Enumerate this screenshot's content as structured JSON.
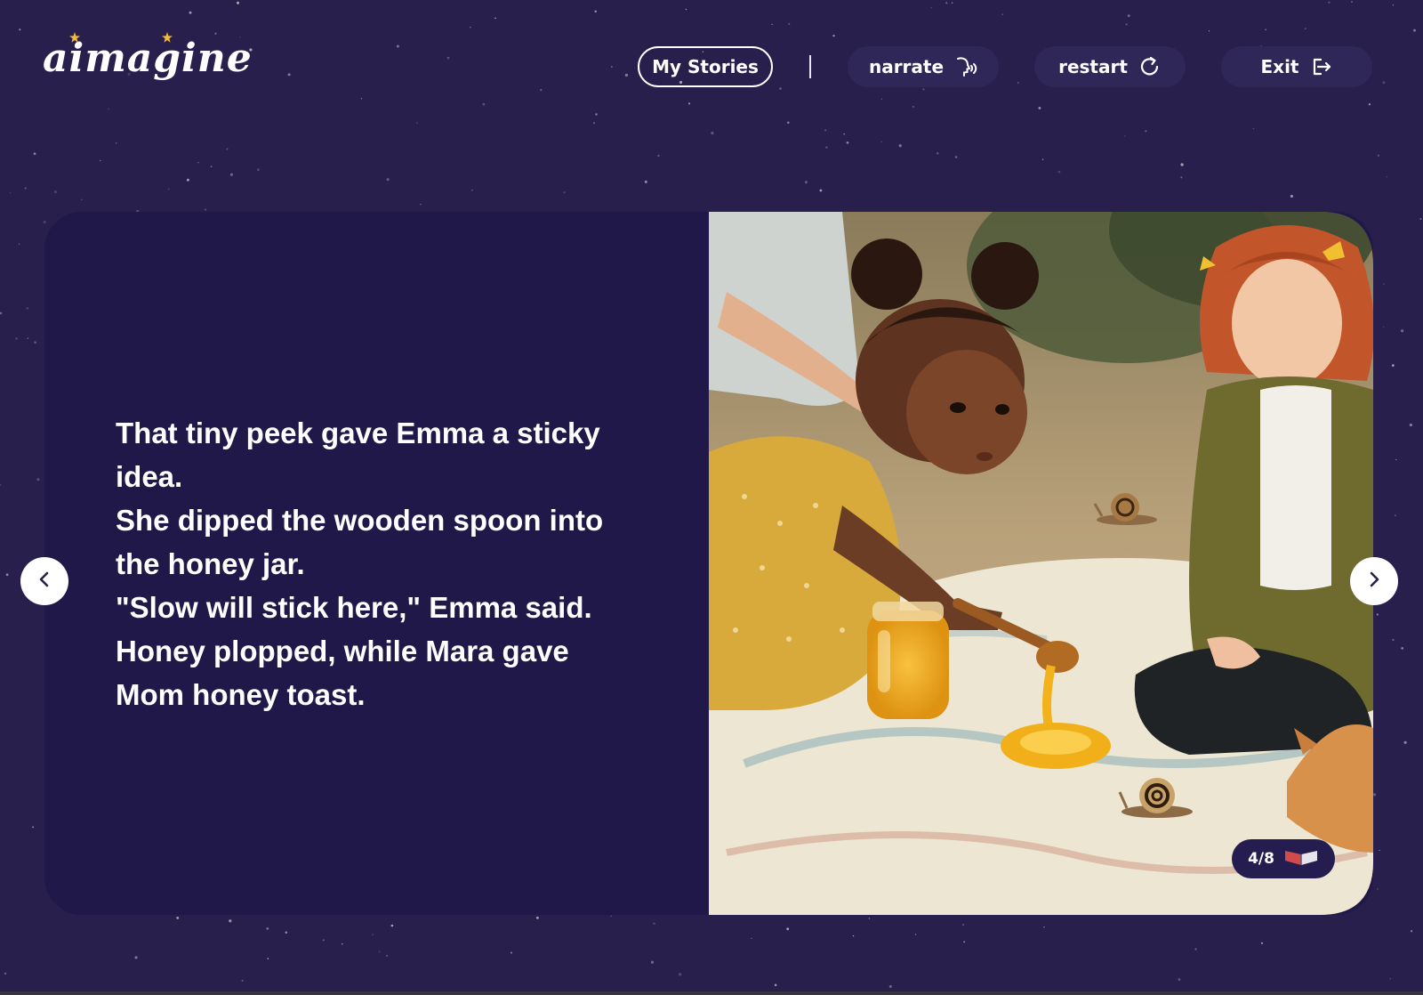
{
  "app": {
    "logo_text": "aimagine"
  },
  "header": {
    "my_stories_label": "My Stories",
    "narrate_label": "narrate",
    "restart_label": "restart",
    "exit_label": "Exit",
    "icons": {
      "narrate": "speaking-head-icon",
      "restart": "refresh-icon",
      "exit": "logout-icon"
    }
  },
  "story": {
    "lines": [
      "That tiny peek gave Emma a sticky",
      "idea.",
      "She dipped the wooden spoon into",
      "the honey jar.",
      "\"Slow will stick here,\" Emma said.",
      "Honey plopped, while Mara gave",
      "Mom honey toast."
    ],
    "page_indicator": "4/8"
  },
  "navigation": {
    "prev_icon": "chevron-left-icon",
    "next_icon": "chevron-right-icon"
  },
  "colors": {
    "background": "#281f4c",
    "card": "#201848",
    "pill": "#2f2758",
    "star_accent": "#f0b93a",
    "text": "#ffffff"
  }
}
